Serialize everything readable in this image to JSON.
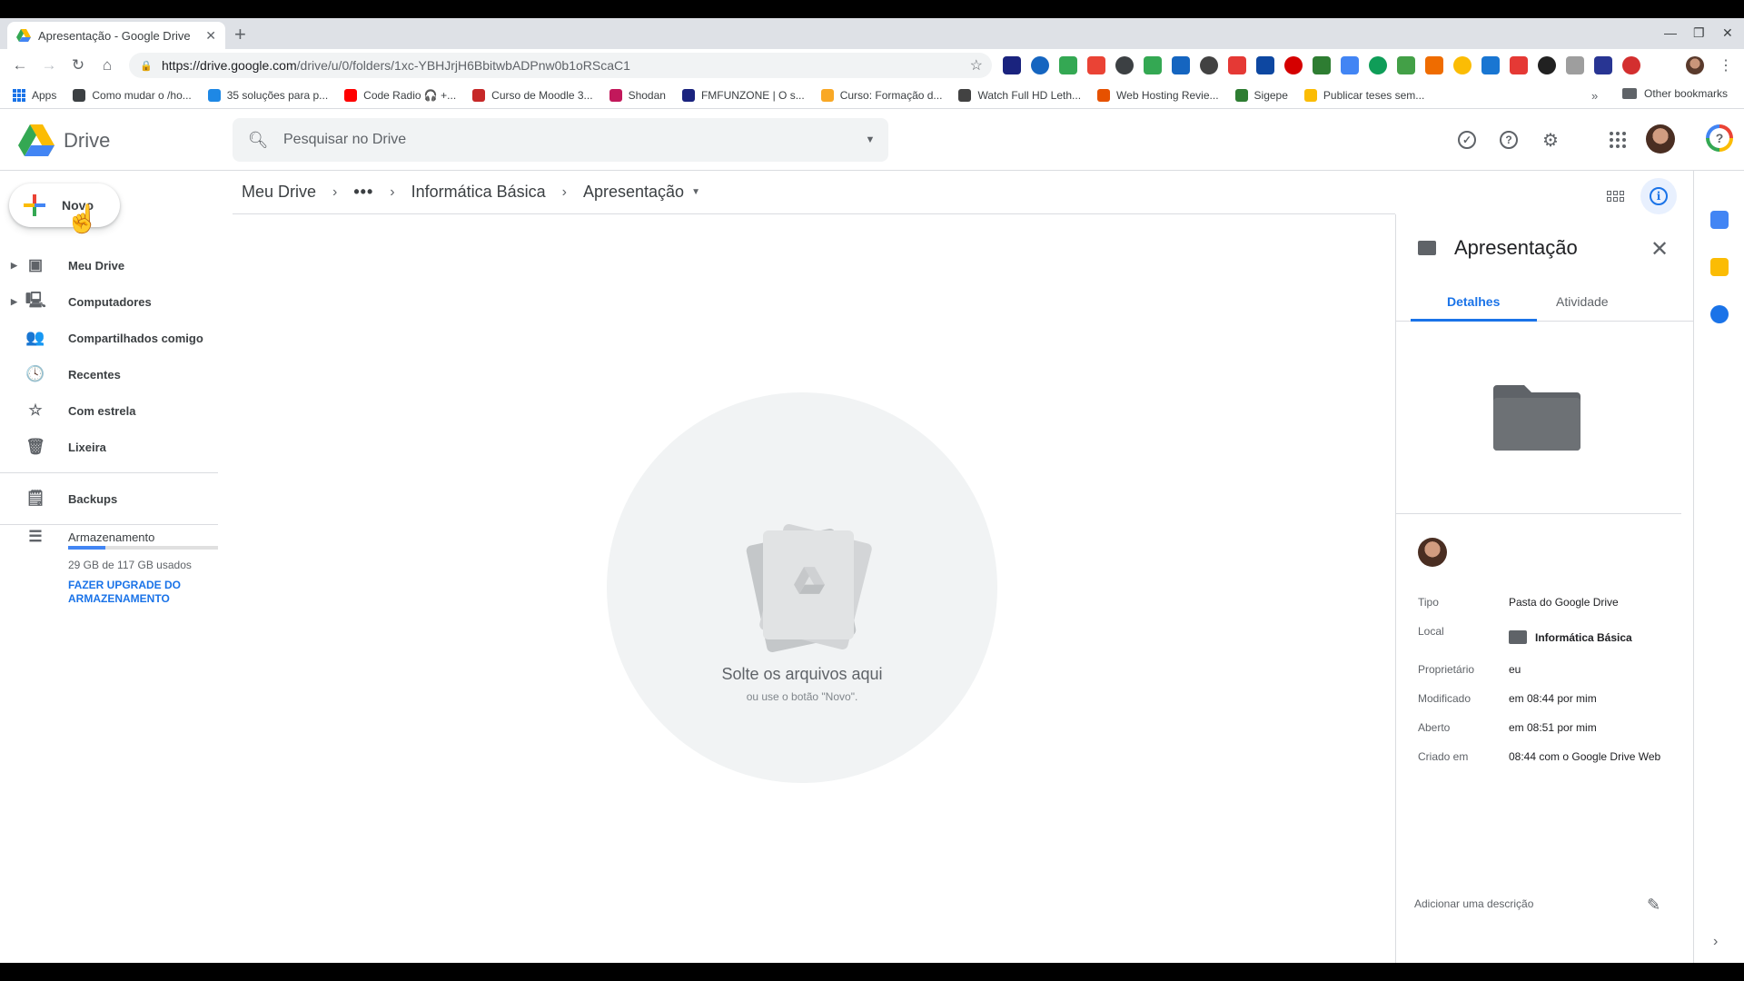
{
  "browser": {
    "tab_title": "Apresentação - Google Drive",
    "tab_close": "✕",
    "new_tab": "+",
    "url_host": "https://drive.google.com",
    "url_path": "/drive/u/0/folders/1xc-YBHJrjH6BbitwbADPnw0b1oRScaC1",
    "bookmarks": [
      {
        "label": "Apps",
        "color": "#1a73e8"
      },
      {
        "label": "Como mudar o /ho...",
        "color": "#3c4043"
      },
      {
        "label": "35 soluções para p...",
        "color": "#1e88e5"
      },
      {
        "label": "Code Radio 🎧 +...",
        "color": "#ff0000"
      },
      {
        "label": "Curso de Moodle 3...",
        "color": "#c62828"
      },
      {
        "label": "Shodan",
        "color": "#c2185b"
      },
      {
        "label": "FMFUNZONE | O s...",
        "color": "#1a237e"
      },
      {
        "label": "Curso: Formação d...",
        "color": "#f9a825"
      },
      {
        "label": "Watch Full HD Leth...",
        "color": "#424242"
      },
      {
        "label": "Web Hosting Revie...",
        "color": "#e65100"
      },
      {
        "label": "Sigepe",
        "color": "#2e7d32"
      },
      {
        "label": "Publicar teses sem...",
        "color": "#fbbc04"
      }
    ],
    "bookmarks_more": "»",
    "other_bookmarks": "Other bookmarks",
    "extension_colors": [
      "#1a237e",
      "#1565c0",
      "#34a853",
      "#ea4335",
      "#3c4043",
      "#34a853",
      "#1565c0",
      "#424242",
      "#e53935",
      "#0d47a1",
      "#d50000",
      "#2e7d32",
      "#4285f4",
      "#0f9d58",
      "#43a047",
      "#ef6c00",
      "#fbbc04",
      "#1976d2",
      "#e53935",
      "#212121",
      "#9e9e9e",
      "#283593",
      "#d32f2f"
    ]
  },
  "header": {
    "logo_text": "Drive",
    "search_placeholder": "Pesquisar no Drive"
  },
  "sidebar": {
    "new_label": "Novo",
    "items": [
      {
        "label": "Meu Drive",
        "icon": "drive-icon",
        "glyph": "▣",
        "caret": true
      },
      {
        "label": "Computadores",
        "icon": "computers-icon",
        "glyph": "🖳",
        "caret": true
      },
      {
        "label": "Compartilhados comigo",
        "icon": "shared-icon",
        "glyph": "👥",
        "caret": false
      },
      {
        "label": "Recentes",
        "icon": "clock-icon",
        "glyph": "🕓",
        "caret": false
      },
      {
        "label": "Com estrela",
        "icon": "star-icon",
        "glyph": "☆",
        "caret": false
      },
      {
        "label": "Lixeira",
        "icon": "trash-icon",
        "glyph": "🗑",
        "caret": false
      }
    ],
    "backups_label": "Backups",
    "storage_label": "Armazenamento",
    "storage_used_fraction": 0.25,
    "storage_text": "29 GB de 117 GB usados",
    "upgrade_label": "FAZER UPGRADE DO ARMAZENAMENTO"
  },
  "breadcrumb": {
    "root": "Meu Drive",
    "dots": "•••",
    "parent": "Informática Básica",
    "current": "Apresentação"
  },
  "empty_state": {
    "title": "Solte os arquivos aqui",
    "subtitle": "ou use o botão \"Novo\"."
  },
  "details": {
    "title": "Apresentação",
    "tabs": [
      "Detalhes",
      "Atividade"
    ],
    "active_tab": "Detalhes",
    "properties": {
      "tipo_k": "Tipo",
      "tipo_v": "Pasta do Google Drive",
      "local_k": "Local",
      "local_v": "Informática Básica",
      "prop_k": "Proprietário",
      "prop_v": "eu",
      "mod_k": "Modificado",
      "mod_v": "em 08:44 por mim",
      "abe_k": "Aberto",
      "abe_v": "em 08:51 por mim",
      "cri_k": "Criado em",
      "cri_v": "08:44 com o Google Drive Web"
    },
    "description_placeholder": "Adicionar uma descrição"
  },
  "colors": {
    "accent": "#1a73e8",
    "google_blue": "#4285f4",
    "google_red": "#ea4335",
    "google_yellow": "#fbbc04",
    "google_green": "#34a853"
  }
}
